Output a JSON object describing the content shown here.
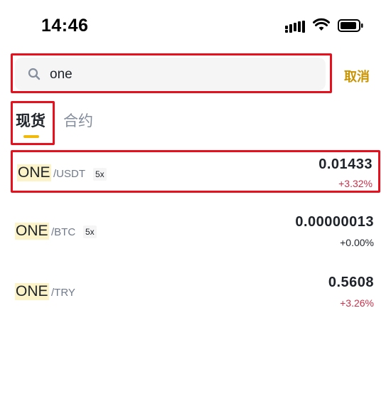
{
  "status_bar": {
    "time": "14:46"
  },
  "search": {
    "value": "one",
    "cancel_label": "取消"
  },
  "tabs": [
    {
      "label": "现货",
      "active": true
    },
    {
      "label": "合约",
      "active": false
    }
  ],
  "results": [
    {
      "base": "ONE",
      "quote": "/USDT",
      "leverage": "5x",
      "price": "0.01433",
      "change": "+3.32%",
      "change_color": "#cf304a"
    },
    {
      "base": "ONE",
      "quote": "/BTC",
      "leverage": "5x",
      "price": "0.00000013",
      "change": "+0.00%",
      "change_color": "#1e2329"
    },
    {
      "base": "ONE",
      "quote": "/TRY",
      "leverage": "",
      "price": "0.5608",
      "change": "+3.26%",
      "change_color": "#cf304a"
    }
  ],
  "colors": {
    "accent": "#f0b90b",
    "cancel": "#c99400",
    "positive": "#cf304a",
    "highlight_box": "#e8101c"
  }
}
